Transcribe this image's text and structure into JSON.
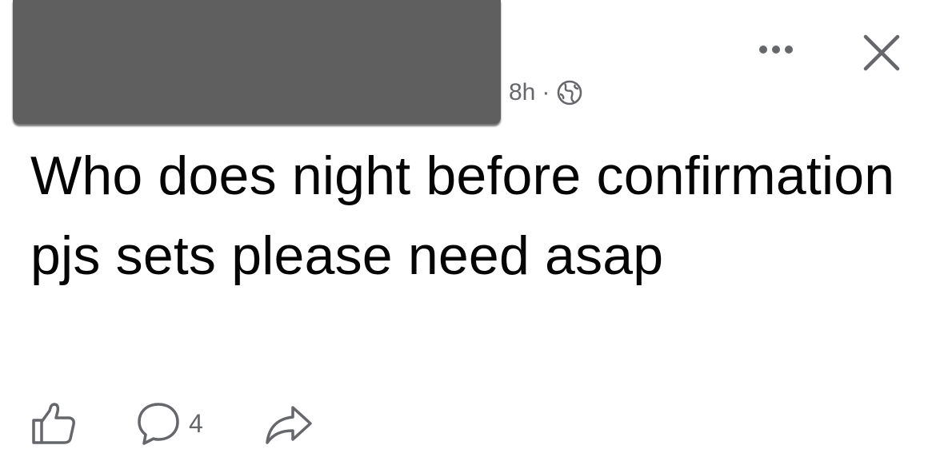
{
  "post": {
    "time_label": "8h",
    "separator": "·",
    "visibility_icon": "globe-icon",
    "text": "Who does night before confirmation pjs sets please need asap"
  },
  "header": {
    "more_icon": "more-options-icon",
    "close_icon": "close-icon"
  },
  "actions": {
    "like_icon": "thumbs-up-icon",
    "comment_icon": "comment-bubble-icon",
    "comment_count": "4",
    "share_icon": "share-arrow-icon"
  },
  "colors": {
    "text_primary": "#050505",
    "text_secondary": "#65676b",
    "redaction": "#5f5f5f"
  }
}
